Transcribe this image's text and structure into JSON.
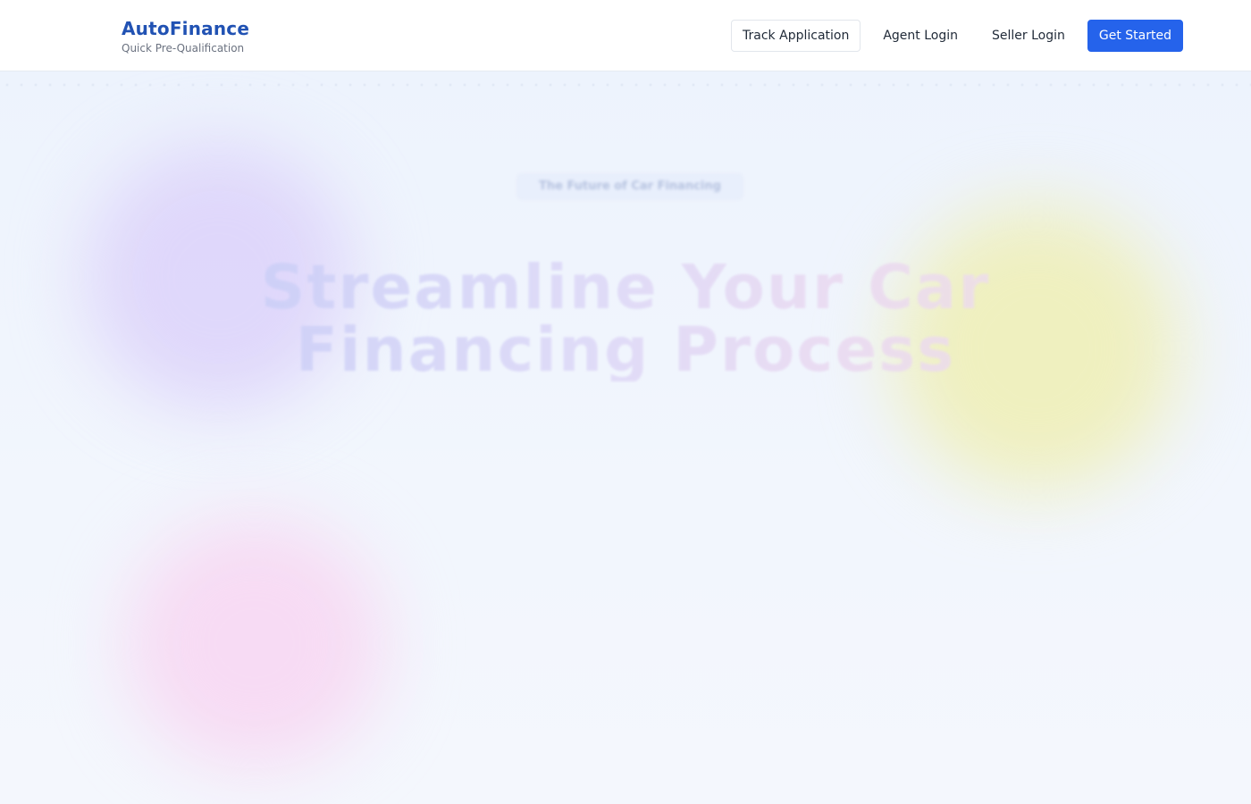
{
  "header": {
    "brand": "AutoFinance",
    "tagline": "Quick Pre-Qualification",
    "track_application": "Track Application",
    "agent_login": "Agent Login",
    "seller_login": "Seller Login",
    "get_started": "Get Started"
  },
  "hero": {
    "badge": "The Future of Car Financing",
    "title": "Streamline Your Car Financing Process"
  },
  "colors": {
    "brand": "#2152b3",
    "primary": "#2563eb"
  }
}
